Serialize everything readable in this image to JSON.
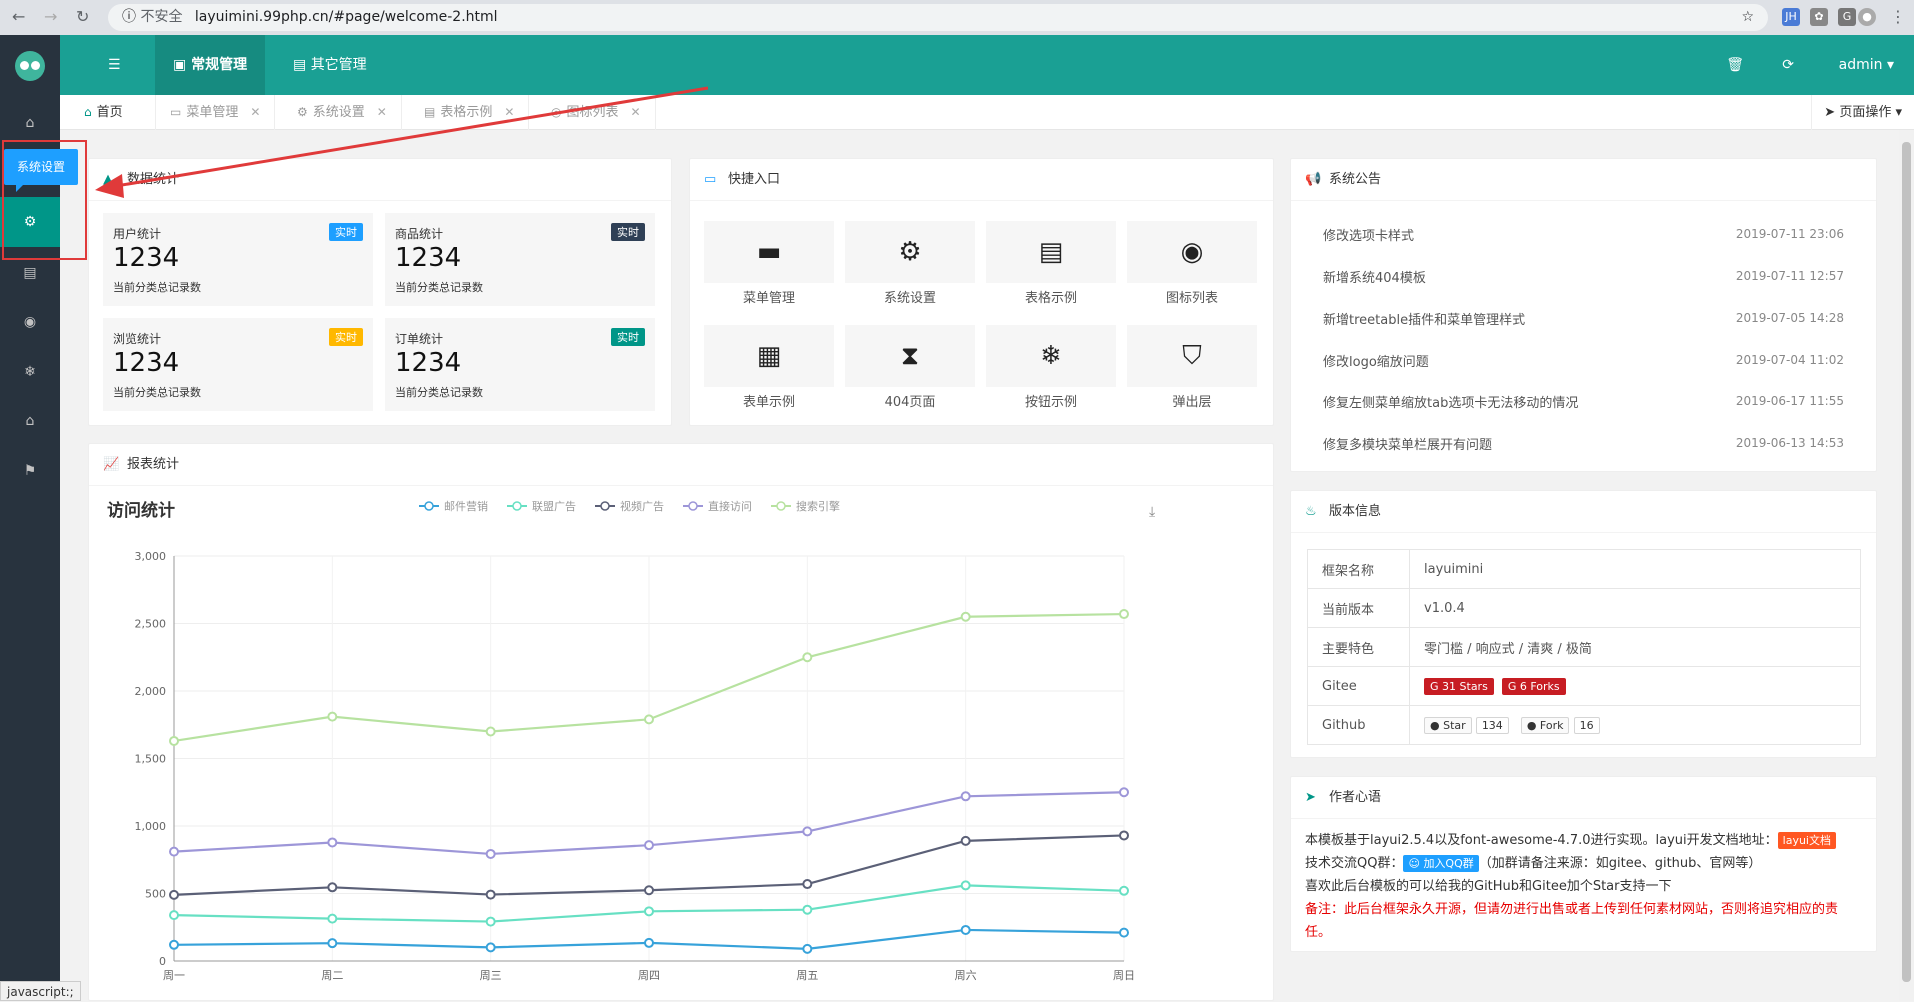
{
  "browser": {
    "insecure": "不安全",
    "url": "layuimini.99php.cn/#page/welcome-2.html",
    "ext_jh": "JH"
  },
  "sidebar": {
    "tooltip": "系统设置",
    "icons": [
      "home-icon",
      "gears-icon",
      "file-icon",
      "dot-circle-icon",
      "snowflake-icon",
      "home-icon",
      "flag-icon"
    ]
  },
  "header": {
    "menu_toggle": "☰",
    "tab1": "常规管理",
    "tab2": "其它管理",
    "user": "admin",
    "trash_icon": "🗑",
    "refresh_icon": "⟳"
  },
  "tabs": [
    {
      "icon": "⌂",
      "label": "首页"
    },
    {
      "icon": "▭",
      "label": "菜单管理"
    },
    {
      "icon": "⚙",
      "label": "系统设置"
    },
    {
      "icon": "▤",
      "label": "表格示例"
    },
    {
      "icon": "◎",
      "label": "图标列表"
    }
  ],
  "page_op": "页面操作",
  "stats": {
    "title": "数据统计",
    "items": [
      {
        "label": "用户统计",
        "value": "1234",
        "desc": "当前分类总记录数",
        "badge": "实时",
        "color": "#1e9fff"
      },
      {
        "label": "商品统计",
        "value": "1234",
        "desc": "当前分类总记录数",
        "badge": "实时",
        "color": "#2f4056"
      },
      {
        "label": "浏览统计",
        "value": "1234",
        "desc": "当前分类总记录数",
        "badge": "实时",
        "color": "#ffb800"
      },
      {
        "label": "订单统计",
        "value": "1234",
        "desc": "当前分类总记录数",
        "badge": "实时",
        "color": "#009688"
      }
    ]
  },
  "quick": {
    "title": "快捷入口",
    "items": [
      {
        "icon": "▬",
        "label": "菜单管理"
      },
      {
        "icon": "⚙",
        "label": "系统设置"
      },
      {
        "icon": "▤",
        "label": "表格示例"
      },
      {
        "icon": "◉",
        "label": "图标列表"
      },
      {
        "icon": "▦",
        "label": "表单示例"
      },
      {
        "icon": "⧗",
        "label": "404页面"
      },
      {
        "icon": "❄",
        "label": "按钮示例"
      },
      {
        "icon": "⛉",
        "label": "弹出层"
      }
    ]
  },
  "notices": {
    "title": "系统公告",
    "items": [
      {
        "text": "修改选项卡样式",
        "date": "2019-07-11 23:06"
      },
      {
        "text": "新增系统404模板",
        "date": "2019-07-11 12:57"
      },
      {
        "text": "新增treetable插件和菜单管理样式",
        "date": "2019-07-05 14:28"
      },
      {
        "text": "修改logo缩放问题",
        "date": "2019-07-04 11:02"
      },
      {
        "text": "修复左侧菜单缩放tab选项卡无法移动的情况",
        "date": "2019-06-17 11:55"
      },
      {
        "text": "修复多模块菜单栏展开有问题",
        "date": "2019-06-13 14:53"
      }
    ]
  },
  "version": {
    "title": "版本信息",
    "rows": [
      {
        "k": "框架名称",
        "v": "layuimini"
      },
      {
        "k": "当前版本",
        "v": "v1.0.4"
      },
      {
        "k": "主要特色",
        "v": "零门槛 / 响应式 / 清爽 / 极简"
      }
    ],
    "gitee_label": "Gitee",
    "gitee_stars": "31 Stars",
    "gitee_forks": "6 Forks",
    "github_label": "Github",
    "github_star": "Star",
    "github_star_count": "134",
    "github_fork": "Fork",
    "github_fork_count": "16"
  },
  "author": {
    "title": "作者心语",
    "line1": "本模板基于layui2.5.4以及font-awesome-4.7.0进行实现。layui开发文档地址：",
    "doc_btn": "layui文档",
    "line2": "技术交流QQ群：",
    "qq_btn": "加入QQ群",
    "line2b": "（加群请备注来源：如gitee、github、官网等）",
    "line3": "喜欢此后台模板的可以给我的GitHub和Gitee加个Star支持一下",
    "line4": "备注：此后台框架永久开源，但请勿进行出售或者上传到任何素材网站，否则将追究相应的责任。"
  },
  "report": {
    "title": "报表统计"
  },
  "chart_data": {
    "type": "line",
    "title": "访问统计",
    "categories": [
      "周一",
      "周二",
      "周三",
      "周四",
      "周五",
      "周六",
      "周日"
    ],
    "ylim": [
      0,
      3000
    ],
    "yticks": [
      "0",
      "500",
      "1,000",
      "1,500",
      "2,000",
      "2,500",
      "3,000"
    ],
    "series": [
      {
        "name": "邮件营销",
        "color": "#37a2da",
        "values": [
          120,
          132,
          101,
          134,
          90,
          230,
          210
        ]
      },
      {
        "name": "联盟广告",
        "color": "#67e0c3",
        "values": [
          340,
          314,
          292,
          368,
          380,
          560,
          520
        ]
      },
      {
        "name": "视频广告",
        "color": "#5b6077",
        "values": [
          490,
          546,
          492,
          524,
          570,
          890,
          930
        ]
      },
      {
        "name": "直接访问",
        "color": "#9d96d8",
        "values": [
          810,
          878,
          793,
          858,
          960,
          1220,
          1250
        ]
      },
      {
        "name": "搜索引擎",
        "color": "#b7e2a0",
        "values": [
          1630,
          1810,
          1700,
          1790,
          2250,
          2550,
          2570
        ]
      }
    ]
  },
  "status_bar": "javascript:;"
}
